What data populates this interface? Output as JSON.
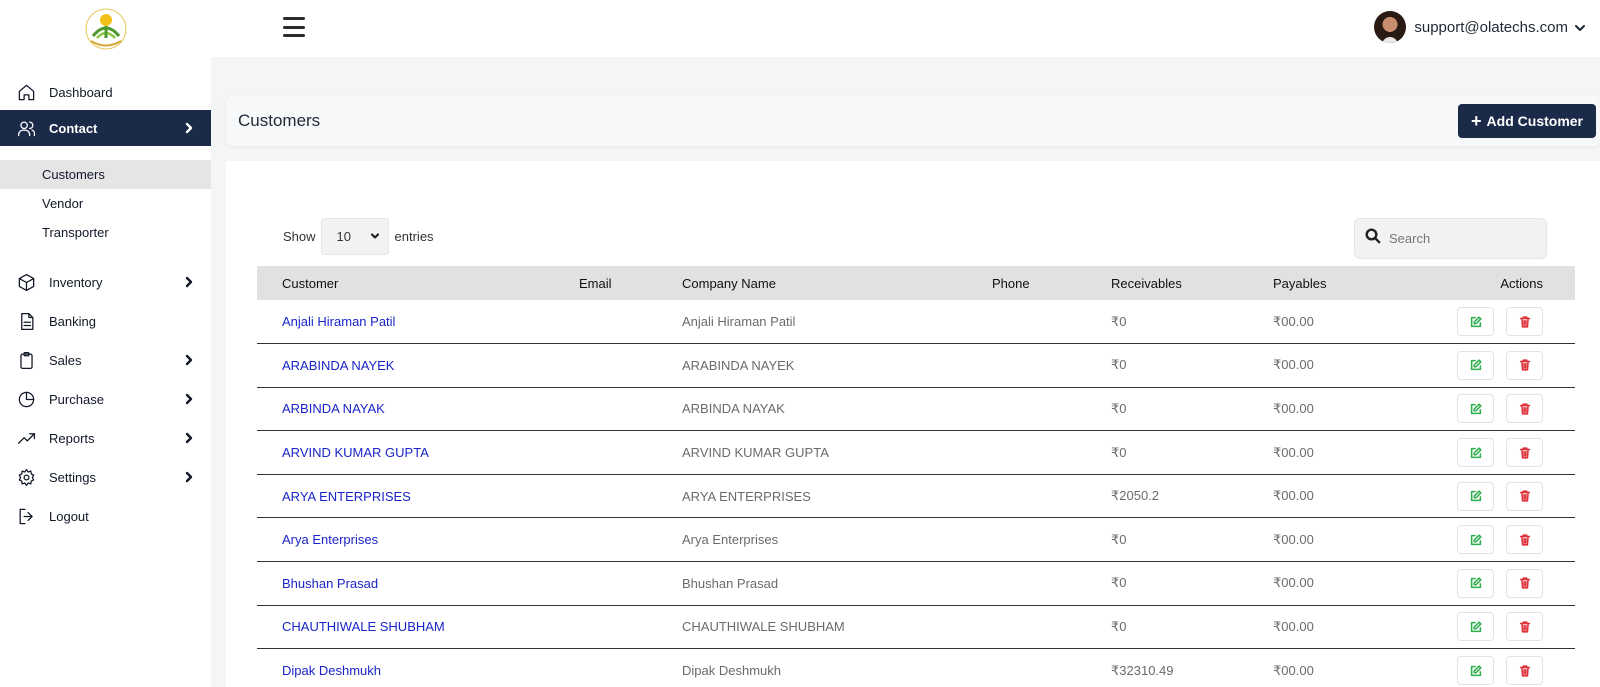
{
  "topbar": {
    "user_email": "support@olatechs.com"
  },
  "sidebar": {
    "items": [
      {
        "label": "Dashboard",
        "icon": "home-icon"
      },
      {
        "label": "Contact",
        "icon": "users-icon"
      },
      {
        "label": "Inventory",
        "icon": "box-icon"
      },
      {
        "label": "Banking",
        "icon": "file-icon"
      },
      {
        "label": "Sales",
        "icon": "clipboard-icon"
      },
      {
        "label": "Purchase",
        "icon": "pie-chart-icon"
      },
      {
        "label": "Reports",
        "icon": "trending-up-icon"
      },
      {
        "label": "Settings",
        "icon": "gear-icon"
      },
      {
        "label": "Logout",
        "icon": "logout-icon"
      }
    ],
    "contact_sub": [
      {
        "label": "Customers"
      },
      {
        "label": "Vendor"
      },
      {
        "label": "Transporter"
      }
    ]
  },
  "page": {
    "title": "Customers",
    "add_button": "Add Customer"
  },
  "table_controls": {
    "show": "Show",
    "entries_value": "10",
    "entries": "entries",
    "search_placeholder": "Search"
  },
  "table": {
    "headers": {
      "customer": "Customer",
      "email": "Email",
      "company": "Company Name",
      "phone": "Phone",
      "receivables": "Receivables",
      "payables": "Payables",
      "actions": "Actions"
    },
    "rows": [
      {
        "customer": "Anjali Hiraman Patil",
        "email": "",
        "company": "Anjali Hiraman Patil",
        "phone": "",
        "receivables": "₹0",
        "payables": "₹00.00"
      },
      {
        "customer": "ARABINDA NAYEK",
        "email": "",
        "company": "ARABINDA NAYEK",
        "phone": "",
        "receivables": "₹0",
        "payables": "₹00.00"
      },
      {
        "customer": "ARBINDA NAYAK",
        "email": "",
        "company": "ARBINDA NAYAK",
        "phone": "",
        "receivables": "₹0",
        "payables": "₹00.00"
      },
      {
        "customer": "ARVIND KUMAR GUPTA",
        "email": "",
        "company": "ARVIND KUMAR GUPTA",
        "phone": "",
        "receivables": "₹0",
        "payables": "₹00.00"
      },
      {
        "customer": "ARYA ENTERPRISES",
        "email": "",
        "company": "ARYA ENTERPRISES",
        "phone": "",
        "receivables": "₹2050.2",
        "payables": "₹00.00"
      },
      {
        "customer": "Arya Enterprises",
        "email": "",
        "company": "Arya Enterprises",
        "phone": "",
        "receivables": "₹0",
        "payables": "₹00.00"
      },
      {
        "customer": "Bhushan Prasad",
        "email": "",
        "company": "Bhushan Prasad",
        "phone": "",
        "receivables": "₹0",
        "payables": "₹00.00"
      },
      {
        "customer": "CHAUTHIWALE SHUBHAM",
        "email": "",
        "company": "CHAUTHIWALE SHUBHAM",
        "phone": "",
        "receivables": "₹0",
        "payables": "₹00.00"
      },
      {
        "customer": "Dipak Deshmukh",
        "email": "",
        "company": "Dipak Deshmukh",
        "phone": "",
        "receivables": "₹32310.49",
        "payables": "₹00.00"
      }
    ]
  },
  "colors": {
    "primary": "#1c2a4a",
    "link": "#1a25c9",
    "edit": "#2fae4f",
    "delete": "#e0313a"
  }
}
